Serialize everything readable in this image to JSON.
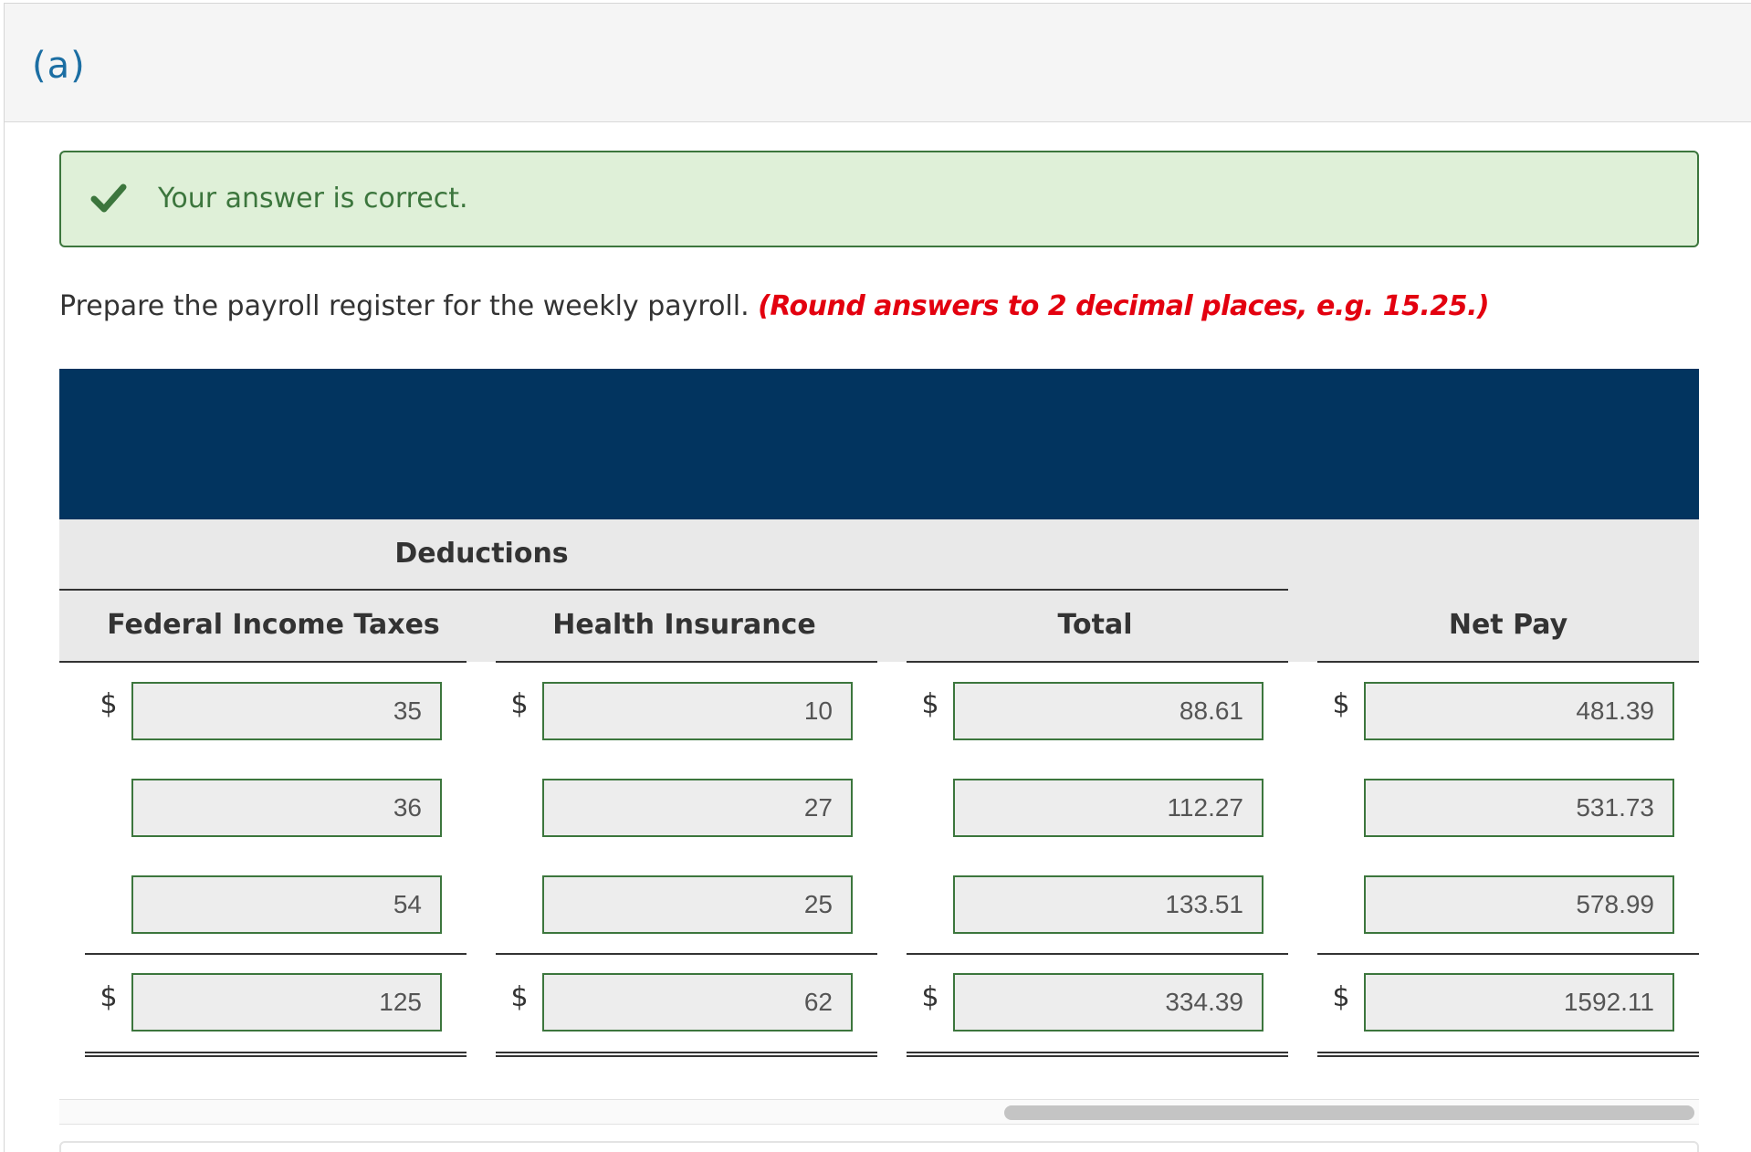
{
  "part": {
    "label": "(a)"
  },
  "feedback": {
    "message": "Your answer is correct.",
    "icon": "checkmark-icon",
    "color": "#3c763d",
    "background": "#dff0d8"
  },
  "instructions": {
    "text": "Prepare the payroll register for the weekly payroll.",
    "hint": "(Round answers to 2 decimal places, e.g. 15.25.)"
  },
  "table": {
    "banner_color": "#02345f",
    "group_header": "Deductions",
    "columns": [
      "Federal Income Taxes",
      "Health Insurance",
      "Total",
      "Net Pay"
    ],
    "currency_symbol": "$",
    "rows": [
      [
        "35",
        "10",
        "88.61",
        "481.39"
      ],
      [
        "36",
        "27",
        "112.27",
        "531.73"
      ],
      [
        "54",
        "25",
        "133.51",
        "578.99"
      ]
    ],
    "totals": [
      "125",
      "62",
      "334.39",
      "1592.11"
    ]
  },
  "scrollbar": {
    "visible_fraction": 0.42
  }
}
